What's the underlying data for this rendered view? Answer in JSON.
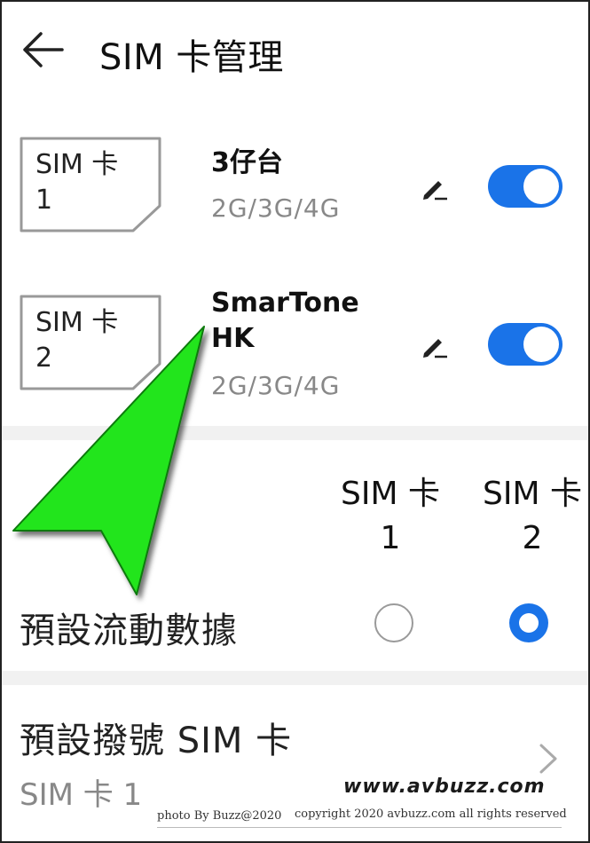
{
  "header": {
    "title": "SIM 卡管理",
    "back_icon": "arrow-left-icon"
  },
  "sim_cards": [
    {
      "card_label": "SIM 卡\n1",
      "card_label_line1": "SIM 卡",
      "card_label_line2": "1",
      "carrier": "3仔台",
      "network": "2G/3G/4G",
      "enabled": true
    },
    {
      "card_label": "SIM 卡\n2",
      "card_label_line1": "SIM 卡",
      "card_label_line2": "2",
      "carrier": "SmarTone HK",
      "network": "2G/3G/4G",
      "enabled": true
    }
  ],
  "mobile_data": {
    "columns": [
      {
        "line1": "SIM 卡",
        "line2": "1"
      },
      {
        "line1": "SIM 卡",
        "line2": "2"
      }
    ],
    "label": "預設流動數據",
    "selected": "SIM 卡 2"
  },
  "default_dial": {
    "label": "預設撥號 SIM 卡",
    "value": "SIM 卡 1"
  },
  "watermark": {
    "site": "www.avbuzz.com",
    "credit": "photo By Buzz@2020",
    "copyright": "copyright 2020 avbuzz.com all rights reserved"
  },
  "colors": {
    "accent": "#1a73e8",
    "cursor": "#22e51f",
    "muted_text": "#888888"
  }
}
